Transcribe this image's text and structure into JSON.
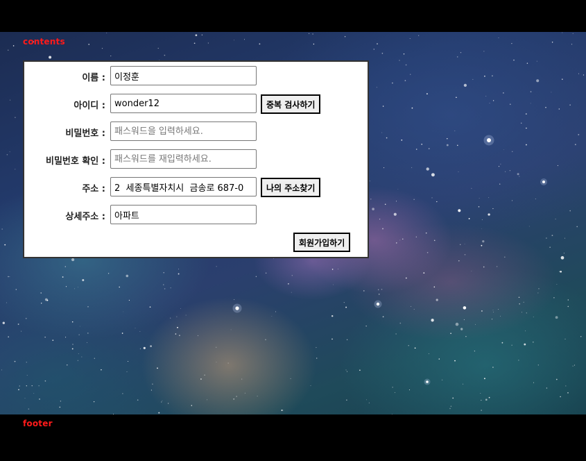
{
  "labels": {
    "contents": "contents",
    "footer": "footer"
  },
  "form": {
    "name": {
      "label": "이름 :",
      "value": "이정훈",
      "placeholder": ""
    },
    "user_id": {
      "label": "아이디 :",
      "value": "wonder12",
      "placeholder": ""
    },
    "password": {
      "label": "비밀번호 :",
      "value": "",
      "placeholder": "패스워드을 입력하세요."
    },
    "password_confirm": {
      "label": "비밀번호 확인 :",
      "value": "",
      "placeholder": "패스워드를 재입력하세요."
    },
    "address": {
      "label": "주소 :",
      "value": "2  세종특별자치시  금송로 687-0"
    },
    "address_detail": {
      "label": "상세주소 :",
      "value": "아파트"
    },
    "buttons": {
      "check_duplicate": "중복 검사하기",
      "find_address": "나의 주소찾기",
      "signup": "회원가입하기"
    }
  },
  "colors": {
    "section_label": "#ff1a1a",
    "panel_border": "#333333",
    "button_bg": "#efefef"
  }
}
